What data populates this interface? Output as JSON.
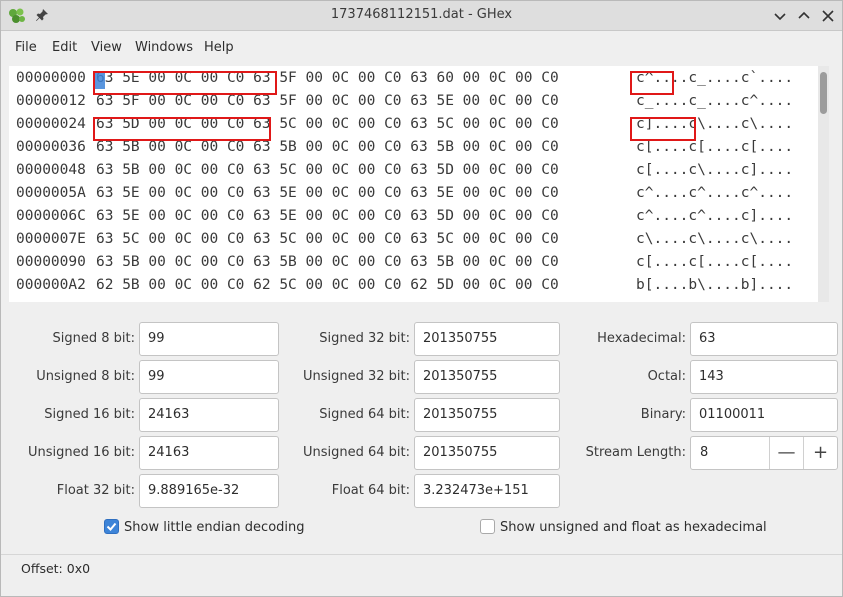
{
  "window": {
    "title": "1737468112151.dat - GHex"
  },
  "menubar": {
    "items": [
      "File",
      "Edit",
      "View",
      "Windows",
      "Help"
    ]
  },
  "hexview": {
    "rows": [
      {
        "offset": "00000000",
        "hex": "63 5E 00 0C 00 C0 63 5F 00 0C 00 C0 63 60 00 0C 00 C0",
        "ascii": "c^....c_....c`...."
      },
      {
        "offset": "00000012",
        "hex": "63 5F 00 0C 00 C0 63 5F 00 0C 00 C0 63 5E 00 0C 00 C0",
        "ascii": "c_....c_....c^...."
      },
      {
        "offset": "00000024",
        "hex": "63 5D 00 0C 00 C0 63 5C 00 0C 00 C0 63 5C 00 0C 00 C0",
        "ascii": "c]....c\\....c\\...."
      },
      {
        "offset": "00000036",
        "hex": "63 5B 00 0C 00 C0 63 5B 00 0C 00 C0 63 5B 00 0C 00 C0",
        "ascii": "c[....c[....c[...."
      },
      {
        "offset": "00000048",
        "hex": "63 5B 00 0C 00 C0 63 5C 00 0C 00 C0 63 5D 00 0C 00 C0",
        "ascii": "c[....c\\....c]...."
      },
      {
        "offset": "0000005A",
        "hex": "63 5E 00 0C 00 C0 63 5E 00 0C 00 C0 63 5E 00 0C 00 C0",
        "ascii": "c^....c^....c^...."
      },
      {
        "offset": "0000006C",
        "hex": "63 5E 00 0C 00 C0 63 5E 00 0C 00 C0 63 5D 00 0C 00 C0",
        "ascii": "c^....c^....c]...."
      },
      {
        "offset": "0000007E",
        "hex": "63 5C 00 0C 00 C0 63 5C 00 0C 00 C0 63 5C 00 0C 00 C0",
        "ascii": "c\\....c\\....c\\...."
      },
      {
        "offset": "00000090",
        "hex": "63 5B 00 0C 00 C0 63 5B 00 0C 00 C0 63 5B 00 0C 00 C0",
        "ascii": "c[....c[....c[...."
      },
      {
        "offset": "000000A2",
        "hex": "62 5B 00 0C 00 C0 62 5C 00 0C 00 C0 62 5D 00 0C 00 C0",
        "ascii": "b[....b\\....b]...."
      }
    ]
  },
  "inspector": {
    "col1": [
      {
        "label": "Signed 8 bit:",
        "value": "99"
      },
      {
        "label": "Unsigned 8 bit:",
        "value": "99"
      },
      {
        "label": "Signed 16 bit:",
        "value": "24163"
      },
      {
        "label": "Unsigned 16 bit:",
        "value": "24163"
      },
      {
        "label": "Float 32 bit:",
        "value": "9.889165e-32"
      }
    ],
    "col2": [
      {
        "label": "Signed 32 bit:",
        "value": "201350755"
      },
      {
        "label": "Unsigned 32 bit:",
        "value": "201350755"
      },
      {
        "label": "Signed 64 bit:",
        "value": "201350755"
      },
      {
        "label": "Unsigned 64 bit:",
        "value": "201350755"
      },
      {
        "label": "Float 64 bit:",
        "value": "3.232473e+151"
      }
    ],
    "col3": [
      {
        "label": "Hexadecimal:",
        "value": "63"
      },
      {
        "label": "Octal:",
        "value": "143"
      },
      {
        "label": "Binary:",
        "value": "01100011"
      },
      {
        "label": "Stream Length:",
        "value": "8"
      }
    ],
    "stepper": {
      "minus": "—",
      "plus": "+"
    },
    "little_endian_label": "Show little endian decoding",
    "little_endian_checked": true,
    "unsigned_hex_label": "Show unsigned and float as hexadecimal",
    "unsigned_hex_checked": false
  },
  "status": {
    "offset_text": "Offset: 0x0"
  },
  "colors": {
    "highlight": "#e01818",
    "cursor": "#3d84d8"
  }
}
